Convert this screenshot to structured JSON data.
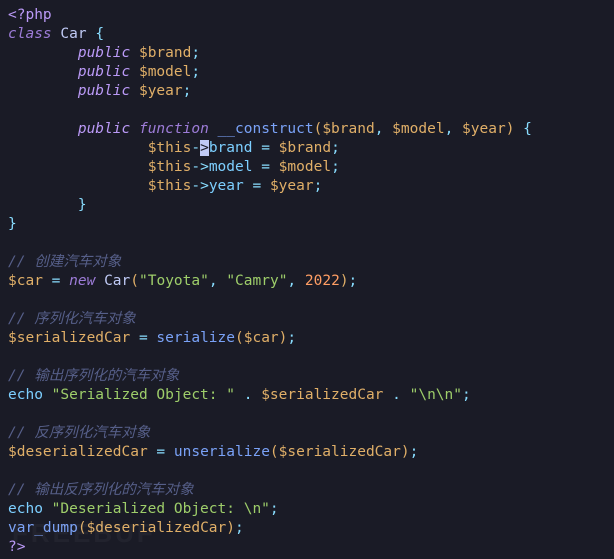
{
  "watermark": "FREEBUF",
  "code": {
    "open_tag": "<?php",
    "close_tag": "?>",
    "kw_class": "class",
    "kw_public": "public",
    "kw_function": "function",
    "kw_new": "new",
    "kw_echo": "echo",
    "fn_construct": "__construct",
    "fn_serialize": "serialize",
    "fn_unserialize": "unserialize",
    "fn_var_dump": "var_dump",
    "class_name": "Car",
    "props": {
      "brand": "brand",
      "model": "model",
      "year": "year"
    },
    "vars": {
      "this": "$this",
      "brand": "$brand",
      "model": "$model",
      "year": "$year",
      "car": "$car",
      "serializedCar": "$serializedCar",
      "deserializedCar": "$deserializedCar"
    },
    "strings": {
      "toyota": "\"Toyota\"",
      "camry": "\"Camry\"",
      "ser_label": "\"Serialized Object: \"",
      "nn": "\"\\n\\n\"",
      "deser_label": "\"Deserialized Object: \\n\"",
      "dot": "."
    },
    "nums": {
      "year": "2022"
    },
    "comments": {
      "c1": "// 创建汽车对象",
      "c2": "// 序列化汽车对象",
      "c3": "// 输出序列化的汽车对象",
      "c4": "// 反序列化汽车对象",
      "c5": "// 输出反序列化的汽车对象"
    }
  }
}
